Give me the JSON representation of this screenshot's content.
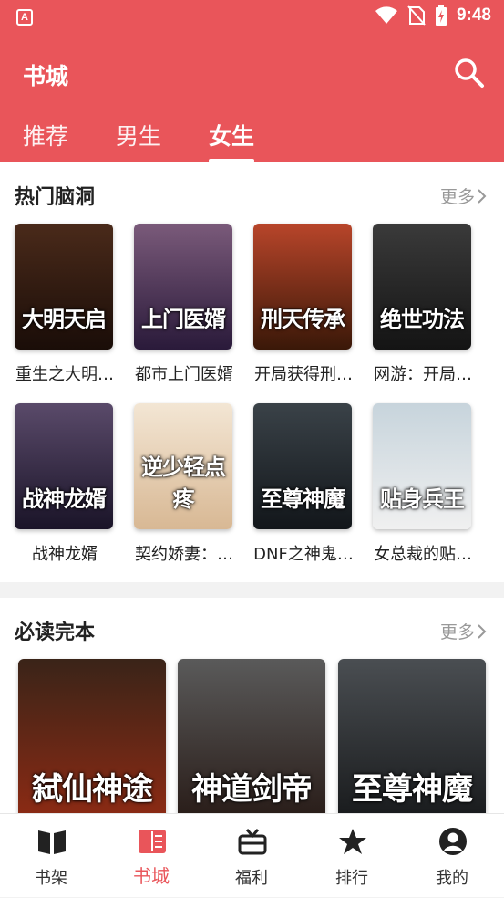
{
  "status_bar": {
    "time": "9:48",
    "app_badge": "A"
  },
  "header": {
    "title": "书城"
  },
  "tabs": [
    {
      "label": "推荐"
    },
    {
      "label": "男生"
    },
    {
      "label": "女生"
    }
  ],
  "sections": {
    "hot": {
      "title": "热门脑洞",
      "more": "更多",
      "books": [
        {
          "name": "重生之大明…",
          "cover_text": "大明天启",
          "color_top": "#4a2a1a",
          "color_bottom": "#1a0d08"
        },
        {
          "name": "都市上门医婿",
          "cover_text": "上门医婿",
          "color_top": "#7a5a7a",
          "color_bottom": "#2a1a3a"
        },
        {
          "name": "开局获得刑…",
          "cover_text": "刑天传承",
          "color_top": "#b8452a",
          "color_bottom": "#3a1808"
        },
        {
          "name": "网游：开局…",
          "cover_text": "绝世功法",
          "color_top": "#3a3a3a",
          "color_bottom": "#141414"
        },
        {
          "name": "战神龙婿",
          "cover_text": "战神龙婿",
          "color_top": "#5a4a6a",
          "color_bottom": "#1a1428"
        },
        {
          "name": "契约娇妻：…",
          "cover_text": "逆少轻点疼",
          "color_top": "#f3e6d4",
          "color_bottom": "#d8b894"
        },
        {
          "name": "DNF之神鬼…",
          "cover_text": "至尊神魔",
          "color_top": "#3a4248",
          "color_bottom": "#12161a"
        },
        {
          "name": "女总裁的贴…",
          "cover_text": "贴身兵王",
          "color_top": "#c7d4dc",
          "color_bottom": "#f0f0f0"
        }
      ]
    },
    "finished": {
      "title": "必读完本",
      "more": "更多",
      "books": [
        {
          "cover_text": "弑仙神途",
          "color_top": "#3a2418",
          "color_bottom": "#8a2a14"
        },
        {
          "cover_text": "神道剑帝",
          "color_top": "#5a5a5a",
          "color_bottom": "#2a1e1a"
        },
        {
          "cover_text": "至尊神魔",
          "color_top": "#4a4e52",
          "color_bottom": "#1a1c1e"
        }
      ]
    }
  },
  "bottom_nav": [
    {
      "label": "书架",
      "icon": "bookshelf-icon"
    },
    {
      "label": "书城",
      "icon": "bookstore-icon"
    },
    {
      "label": "福利",
      "icon": "gift-icon"
    },
    {
      "label": "排行",
      "icon": "rank-star-icon"
    },
    {
      "label": "我的",
      "icon": "profile-icon"
    }
  ],
  "colors": {
    "brand": "#e9555a",
    "active_nav": "#e9555a"
  }
}
